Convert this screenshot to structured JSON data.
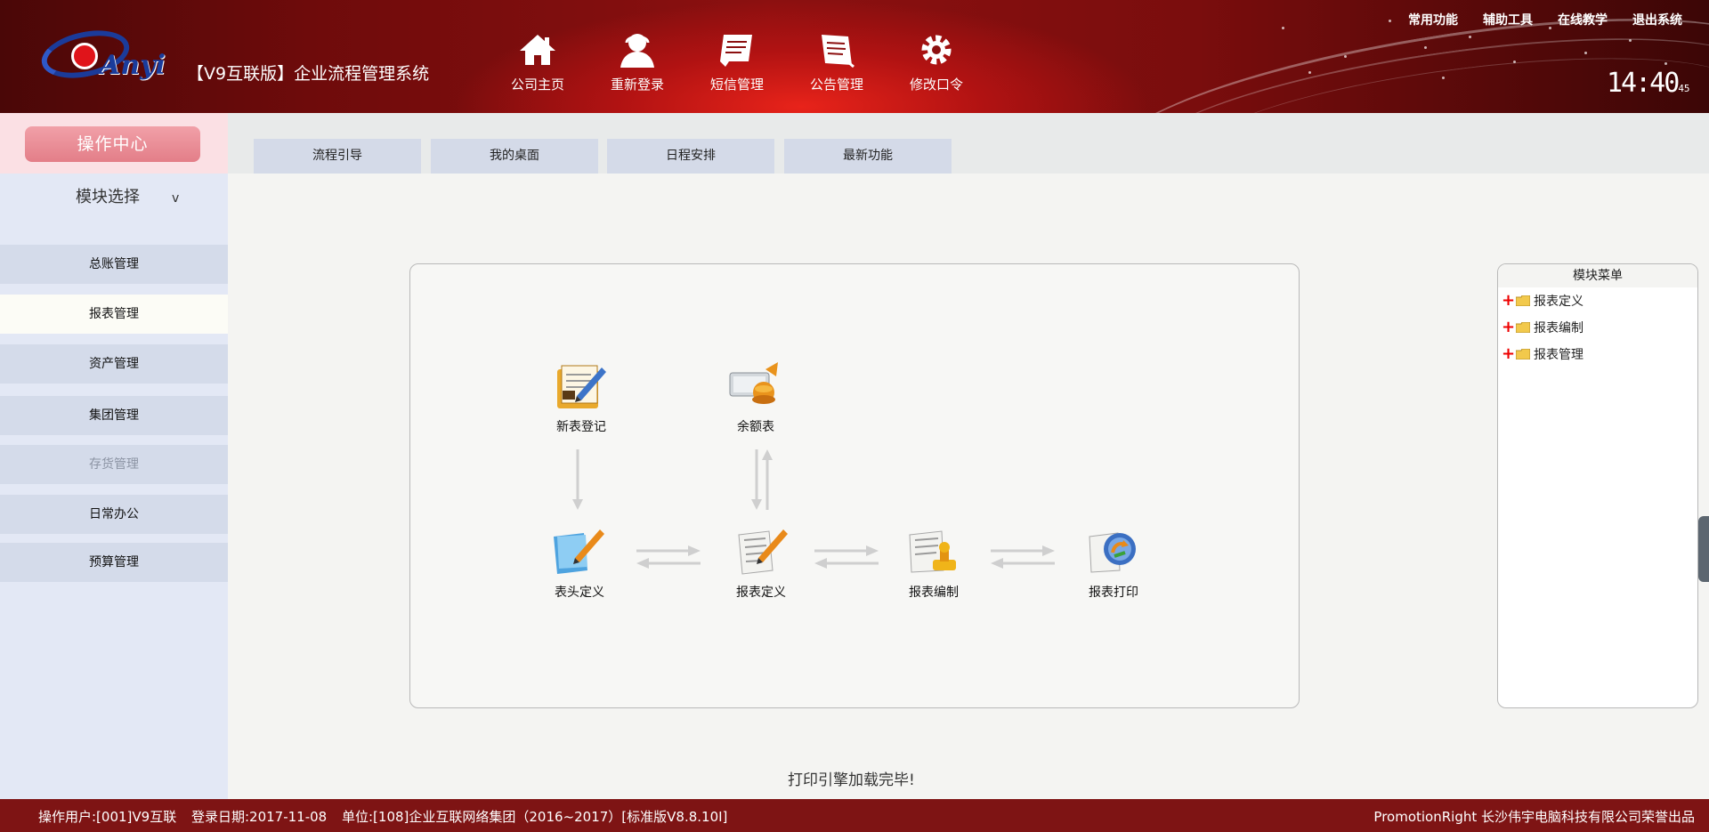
{
  "header": {
    "logo_text": "Anyi",
    "app_title": "【V9互联版】企业流程管理系统",
    "nav": [
      {
        "label": "公司主页",
        "icon": "home-icon"
      },
      {
        "label": "重新登录",
        "icon": "user-icon"
      },
      {
        "label": "短信管理",
        "icon": "message-icon"
      },
      {
        "label": "公告管理",
        "icon": "notice-icon"
      },
      {
        "label": "修改口令",
        "icon": "gear-icon"
      }
    ],
    "top_links": [
      "常用功能",
      "辅助工具",
      "在线教学",
      "退出系统"
    ],
    "clock": "14:40",
    "clock_suffix": "45"
  },
  "sidebar": {
    "op_center": "操作中心",
    "module_select": "模块选择",
    "module_chevron": "v",
    "items": [
      {
        "label": "总账管理",
        "state": "normal"
      },
      {
        "label": "报表管理",
        "state": "active"
      },
      {
        "label": "资产管理",
        "state": "normal"
      },
      {
        "label": "集团管理",
        "state": "normal"
      },
      {
        "label": "存货管理",
        "state": "disabled"
      },
      {
        "label": "日常办公",
        "state": "normal"
      },
      {
        "label": "预算管理",
        "state": "normal"
      }
    ]
  },
  "tabs": [
    "流程引导",
    "我的桌面",
    "日程安排",
    "最新功能"
  ],
  "flow": {
    "nodes": [
      {
        "label": "新表登记",
        "icon": "new-form-icon"
      },
      {
        "label": "余额表",
        "icon": "balance-icon"
      },
      {
        "label": "表头定义",
        "icon": "header-define-icon"
      },
      {
        "label": "报表定义",
        "icon": "report-define-icon"
      },
      {
        "label": "报表编制",
        "icon": "report-compile-icon"
      },
      {
        "label": "报表打印",
        "icon": "report-print-icon"
      }
    ]
  },
  "module_menu": {
    "title": "模块菜单",
    "items": [
      "报表定义",
      "报表编制",
      "报表管理"
    ]
  },
  "status_message": "打印引擎加载完毕!",
  "footer": {
    "user": "操作用户:[001]V9互联",
    "login_date": "登录日期:2017-11-08",
    "unit": "单位:[108]企业互联网络集团（2016~2017）[标准版V8.8.10I]",
    "credit": "PromotionRight 长沙伟宇电脑科技有限公司荣誉出品"
  },
  "colors": {
    "header_red": "#8c1010",
    "footer": "#7e1414",
    "sidebar": "#e3e8f5",
    "tab": "#d4dae8",
    "op_center_button": "#e37e88"
  }
}
